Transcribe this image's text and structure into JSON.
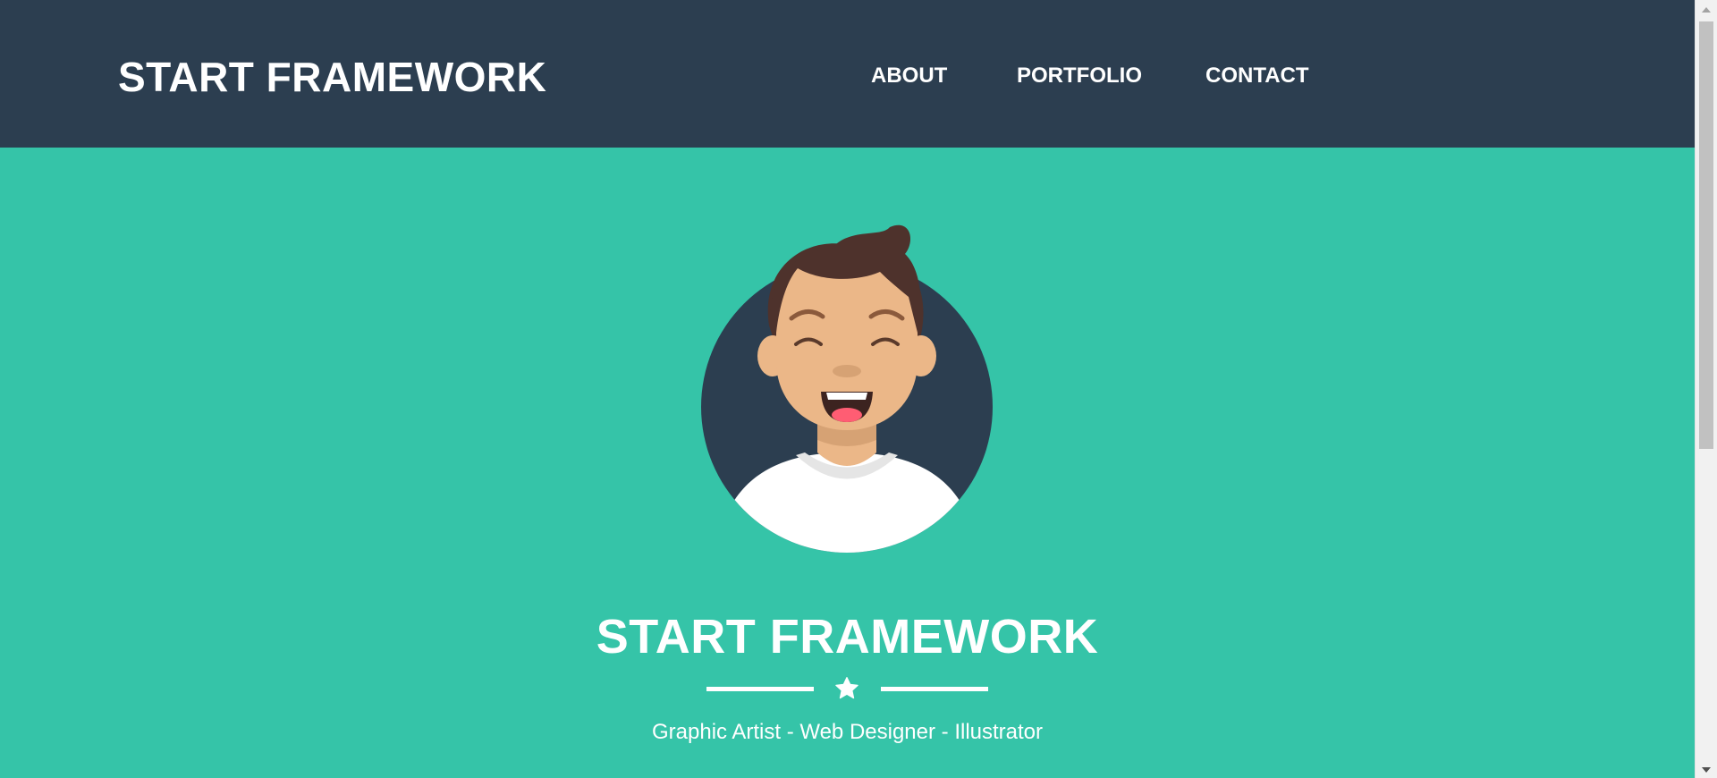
{
  "navbar": {
    "brand": "START FRAMEWORK",
    "links": [
      {
        "label": "ABOUT"
      },
      {
        "label": "PORTFOLIO"
      },
      {
        "label": "CONTACT"
      }
    ]
  },
  "masthead": {
    "avatar_icon": "smiling-man-avatar",
    "heading": "START FRAMEWORK",
    "divider_icon": "star-icon",
    "subheading": "Graphic Artist - Web Designer - Illustrator"
  },
  "colors": {
    "navbar_bg": "#2c3e50",
    "masthead_bg": "#35c4a8",
    "text": "#ffffff"
  }
}
